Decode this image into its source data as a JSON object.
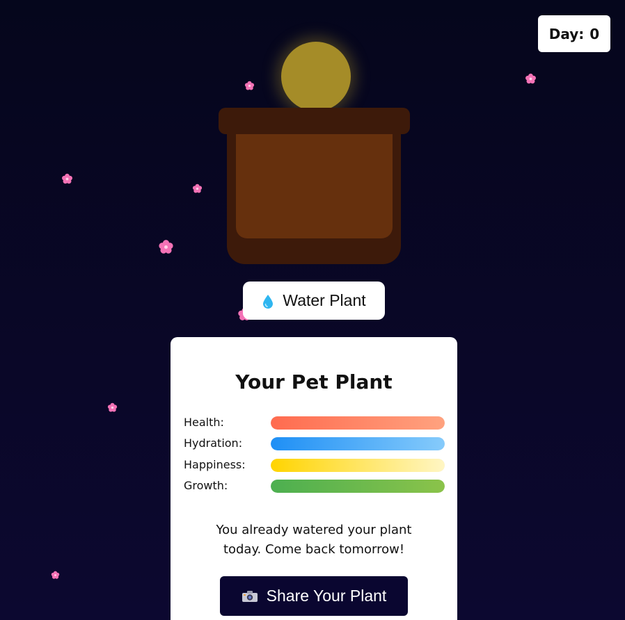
{
  "header": {
    "day_label": "Day:",
    "day_value": "0"
  },
  "plant": {
    "sun_color": "#a58c28",
    "pot_color": "#3d1a0a",
    "soil_color": "#66300d"
  },
  "actions": {
    "water_label": "Water Plant",
    "water_icon": "water-drop-icon",
    "share_label": "Share Your Plant",
    "share_icon": "camera-icon"
  },
  "card": {
    "title": "Your Pet Plant",
    "stats": [
      {
        "label": "Health:",
        "level": 1.0,
        "color_from": "#ff6b4f",
        "color_to": "#ffa27f"
      },
      {
        "label": "Hydration:",
        "level": 1.0,
        "color_from": "#1e8ff5",
        "color_to": "#86cbfb"
      },
      {
        "label": "Happiness:",
        "level": 1.0,
        "color_from": "#ffd400",
        "color_to": "#fff6c4"
      },
      {
        "label": "Growth:",
        "level": 1.0,
        "color_from": "#4caf50",
        "color_to": "#8bc34a"
      }
    ],
    "message_line1": "You already watered your plant",
    "message_line2": "today. Come back tomorrow!"
  },
  "colors": {
    "background": "#05061c",
    "flower": "#f472b6",
    "share_button": "#0a0630"
  }
}
